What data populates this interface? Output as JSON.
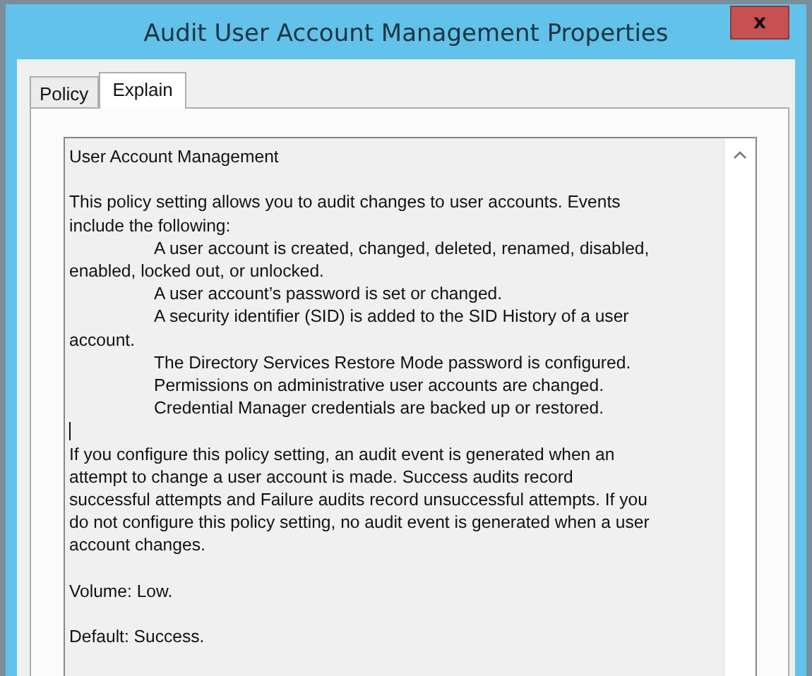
{
  "window": {
    "title": "Audit User Account Management Properties",
    "close": "x"
  },
  "tabs": [
    {
      "label": "Policy",
      "selected": false
    },
    {
      "label": "Explain",
      "selected": true
    }
  ],
  "explain": {
    "blocks": [
      {
        "kind": "text",
        "lines": [
          {
            "text": "User Account Management",
            "indented": false
          }
        ]
      },
      {
        "kind": "text",
        "lines": [
          {
            "text": "This policy setting allows you to audit changes to user accounts. Events",
            "indented": false
          },
          {
            "text": "include the following:",
            "indented": false
          },
          {
            "text": "A user account is created, changed, deleted, renamed, disabled,",
            "indented": true
          },
          {
            "text": "enabled, locked out, or unlocked.",
            "indented": false
          },
          {
            "text": "A user account’s password is set or changed.",
            "indented": true
          },
          {
            "text": "A security identifier (SID) is added to the SID History of a user",
            "indented": true
          },
          {
            "text": "account.",
            "indented": false
          },
          {
            "text": "The Directory Services Restore Mode password is configured.",
            "indented": true
          },
          {
            "text": "Permissions on administrative user accounts are changed.",
            "indented": true
          },
          {
            "text": "Credential Manager credentials are backed up or restored.",
            "indented": true
          }
        ]
      },
      {
        "kind": "caret"
      },
      {
        "kind": "text",
        "lines": [
          {
            "text": "If you configure this policy setting, an audit event is generated when an",
            "indented": false
          },
          {
            "text": "attempt to change a user account is made. Success audits record",
            "indented": false
          },
          {
            "text": "successful attempts and Failure audits record unsuccessful attempts. If you",
            "indented": false
          },
          {
            "text": "do not configure this policy setting, no audit event is generated when a user",
            "indented": false
          },
          {
            "text": "account changes.",
            "indented": false
          }
        ]
      },
      {
        "kind": "text",
        "lines": [
          {
            "text": "Volume: Low.",
            "indented": false
          }
        ]
      },
      {
        "kind": "text",
        "lines": [
          {
            "text": "Default: Success.",
            "indented": false
          }
        ]
      }
    ]
  }
}
